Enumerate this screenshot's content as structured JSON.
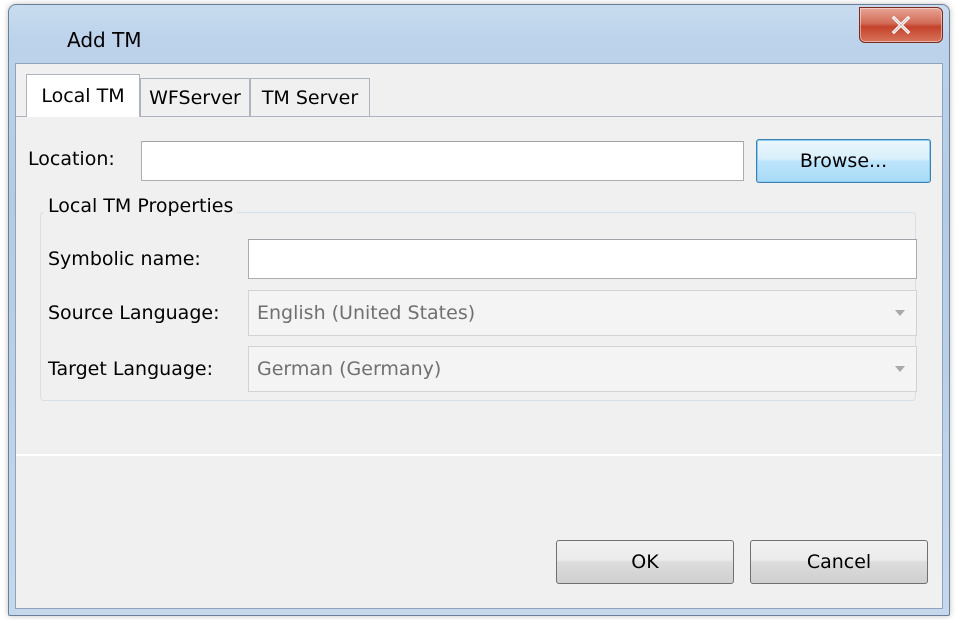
{
  "window": {
    "title": "Add TM",
    "close_icon": "close-icon"
  },
  "tabs": [
    {
      "label": "Local TM",
      "active": true
    },
    {
      "label": "WFServer",
      "active": false
    },
    {
      "label": "TM Server",
      "active": false
    }
  ],
  "location": {
    "label": "Location:",
    "value": "",
    "browse_label": "Browse..."
  },
  "properties": {
    "group_title": "Local TM Properties",
    "symbolic_name_label": "Symbolic name:",
    "symbolic_name_value": "",
    "source_language_label": "Source Language:",
    "source_language_value": "English (United States)",
    "target_language_label": "Target Language:",
    "target_language_value": "German (Germany)"
  },
  "footer": {
    "ok_label": "OK",
    "cancel_label": "Cancel"
  },
  "colors": {
    "title_bar": "#bcd3eb",
    "close_button": "#c4422b",
    "dialog_background": "#f0f0f0",
    "focused_button": "#bee6fd"
  }
}
